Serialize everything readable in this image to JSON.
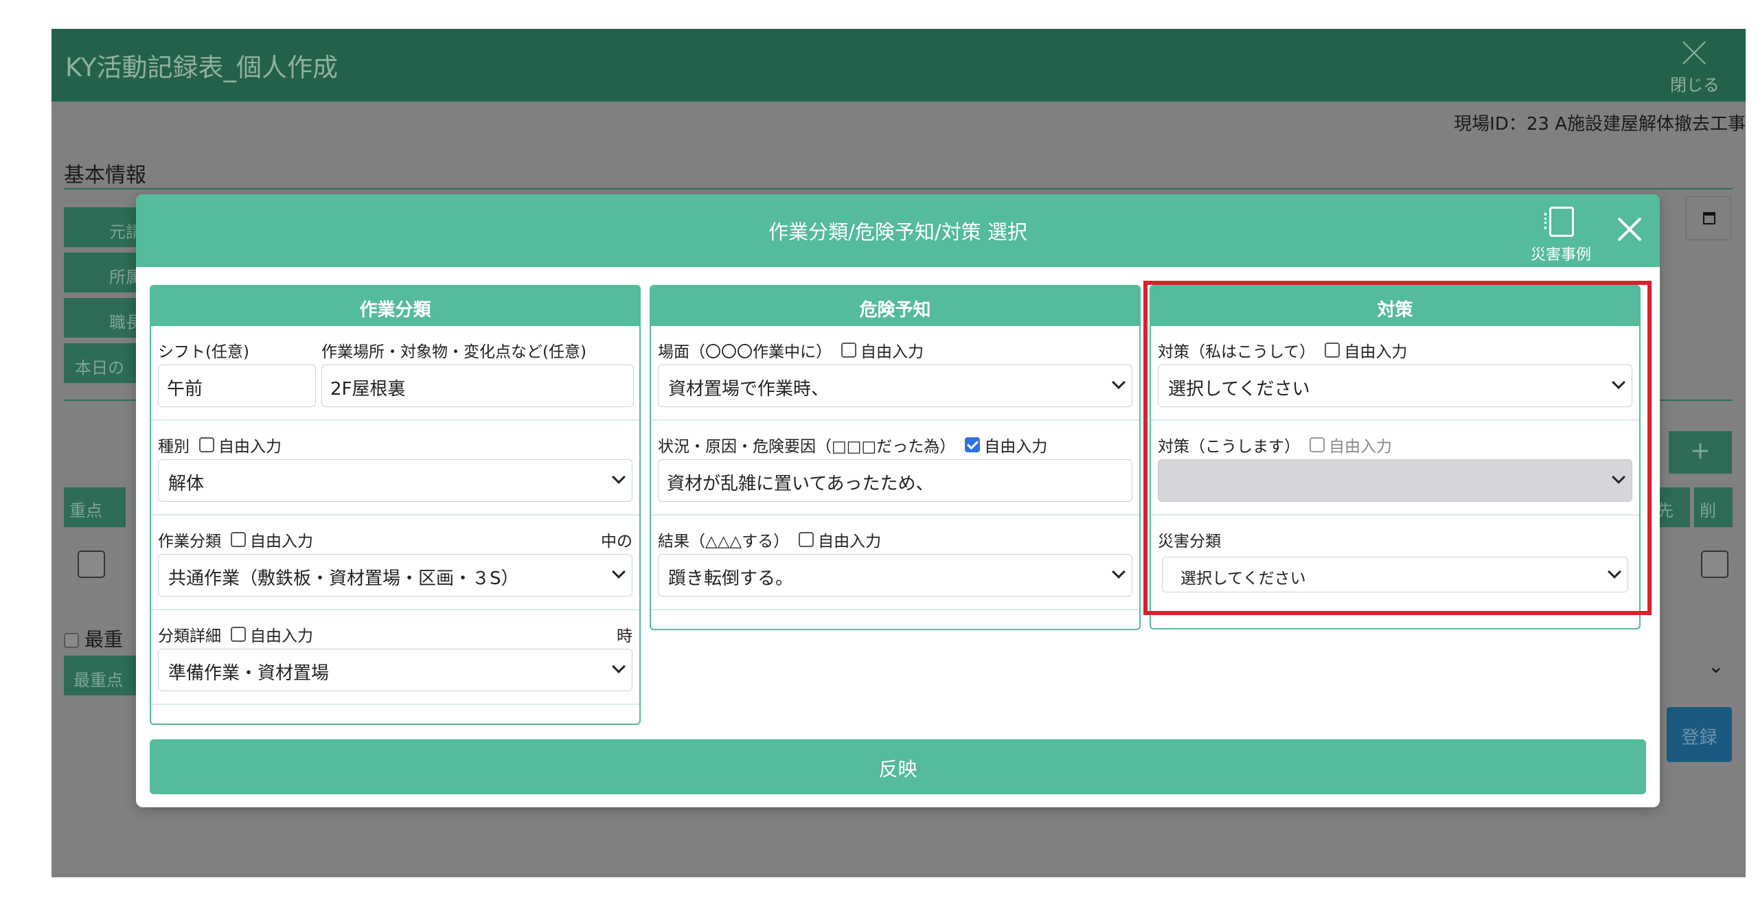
{
  "app": {
    "title": "KY活動記録表_個人作成",
    "close_label": "閉じる",
    "site_id": "現場ID：23 A施設建屋解体撤去工事",
    "section_basic": "基本情報",
    "bg_labels": [
      "元請",
      "所属",
      "職長",
      "本日の"
    ],
    "bg_table_headers": [
      "重点",
      "先",
      "削"
    ],
    "bg_priority_label": "最重",
    "bg_priority_button": "最重点",
    "bg_add_label": "+",
    "bg_register_label": "登録"
  },
  "modal": {
    "title": "作業分類/危険予知/対策 選択",
    "disaster_examples_label": "災害事例",
    "reflect_button": "反映",
    "panels": {
      "work": {
        "title": "作業分類",
        "shift_label": "シフト(任意)",
        "shift_value": "午前",
        "place_label": "作業場所・対象物・変化点など(任意)",
        "place_value": "2F屋根裏",
        "kind_label": "種別",
        "kind_free_label": "自由入力",
        "kind_value": "解体",
        "category_label": "作業分類",
        "category_free_label": "自由入力",
        "category_right_text": "中の",
        "category_value": "共通作業（敷鉄板・資材置場・区画・３S）",
        "detail_label": "分類詳細",
        "detail_free_label": "自由入力",
        "detail_right_text": "時",
        "detail_value": "準備作業・資材置場"
      },
      "hazard": {
        "title": "危険予知",
        "scene_label": "場面（〇〇〇作業中に）",
        "scene_free_label": "自由入力",
        "scene_value": "資材置場で作業時、",
        "cause_label": "状況・原因・危険要因（□□□だった為）",
        "cause_free_label": "自由入力",
        "cause_free_checked": true,
        "cause_value": "資材が乱雑に置いてあったため、",
        "result_label": "結果（△△△する）",
        "result_free_label": "自由入力",
        "result_value": "躓き転倒する。"
      },
      "measure": {
        "title": "対策",
        "mine_label": "対策（私はこうして）",
        "mine_free_label": "自由入力",
        "mine_value": "選択してください",
        "will_label": "対策（こうします）",
        "will_free_label": "自由入力",
        "will_value": "",
        "disaster_label": "災害分類",
        "disaster_value": "選択してください"
      }
    }
  },
  "colors": {
    "header_bg_dimmed": "#24614a",
    "modal_accent": "#54bb9c",
    "highlight": "#d9212c",
    "checkbox_checked": "#2c71e8"
  }
}
